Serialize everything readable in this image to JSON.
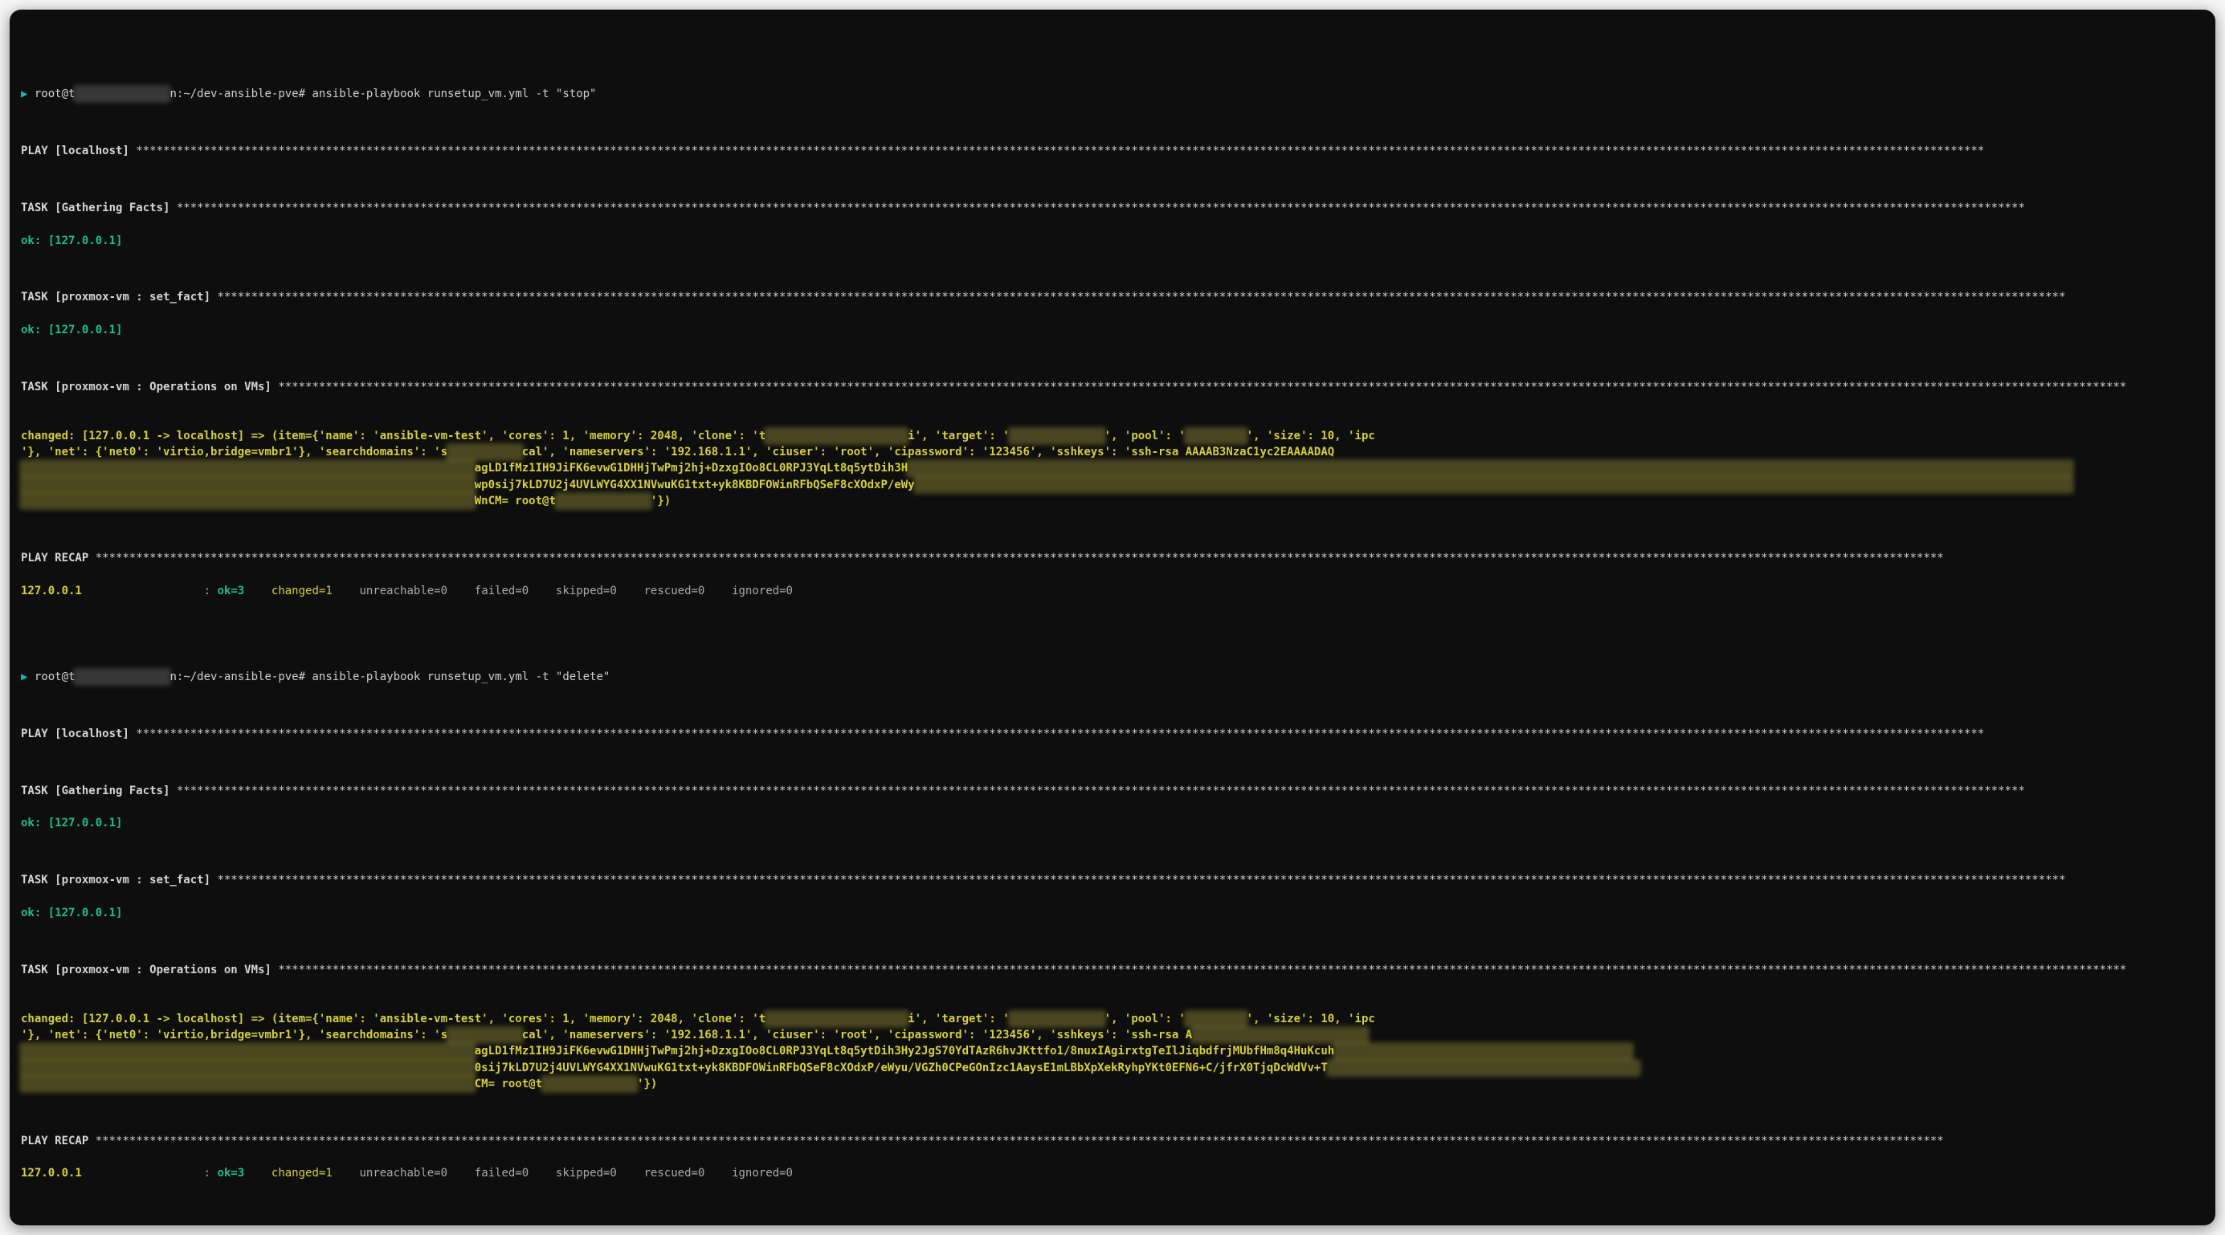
{
  "prompt": {
    "arrow": "▶",
    "user_prefix": "root@t",
    "user_redacted": "xxxxxxxxxxxxxx",
    "path_suffix": "n:~/dev-ansible-pve#",
    "cmd_stop": "ansible-playbook runsetup_vm.yml -t \"stop\"",
    "cmd_delete": "ansible-playbook runsetup_vm.yml -t \"delete\""
  },
  "labels": {
    "play_local": "PLAY [localhost]",
    "task_gather": "TASK [Gathering Facts]",
    "task_setfact": "TASK [proxmox-vm : set_fact]",
    "task_ops": "TASK [proxmox-vm : Operations on VMs]",
    "play_recap": "PLAY RECAP",
    "ok_line": "ok: [127.0.0.1]"
  },
  "stars": "*********************************************************************************************************************************************************************************************************************************************************************************",
  "changed": {
    "prefix": "changed: [127.0.0.1 -> localhost] => (item={'name': 'ansible-vm-test', 'cores': 1, 'memory': 2048, 'clone': 't",
    "after_clone_redact": "i', 'target': '",
    "after_target_redact": "', 'pool': '",
    "after_pool_redact": "', 'size': 10, 'ipc",
    "line2a": "'}, 'net': {'net0': 'virtio,bridge=vmbr1'}, 'searchdomains': 's",
    "line2b": "cal', 'nameservers': '192.168.1.1', 'ciuser': 'root', 'cipassword': '123456', 'sshkeys': 'ssh-rsa AAAAB3NzaC1yc2EAAAADAQ",
    "line3a_stop": "agLD1fMz1IH9JiFK6evwG1DHHjTwPmj2hj+DzxgIOo8CL0RPJ3YqLt8q5ytDih3H",
    "line4a_stop": "wp0sij7kLD7U2j4UVLWYG4XX1NVwuKG1txt+yk8KBDFOWinRFbQSeF8cXOdxP/eWy",
    "line5a_stop": "WnCM= root@t",
    "line5b_stop": "'})",
    "line2b_delete": "cal', 'nameservers': '192.168.1.1', 'ciuser': 'root', 'cipassword': '123456', 'sshkeys': 'ssh-rsa A",
    "line3a_delete": "agLD1fMz1IH9JiFK6evwG1DHHjTwPmj2hj+DzxgIOo8CL0RPJ3YqLt8q5ytDih3Hy2JgS70YdTAzR6hvJKttfo1/8nuxIAgirxtgTeIlJiqbdfrjMUbfHm8q4HuKcuh",
    "line4a_delete": "0sij7kLD7U2j4UVLWYG4XX1NVwuKG1txt+yk8KBDFOWinRFbQSeF8cXOdxP/eWyu/VGZh0CPeGOnIzc1AaysE1mLBbXpXekRyhpYKt0EFN6+C/jfrX0TjqDcWdVv+T",
    "line5a_delete": "CM= root@t",
    "line5b_delete": "'})"
  },
  "recap": {
    "ip": "127.0.0.1",
    "sep": "                  :",
    "ok": "ok=3",
    "changed": "changed=1",
    "unreachable": "unreachable=0",
    "failed": "failed=0",
    "skipped": "skipped=0",
    "rescued": "rescued=0",
    "ignored": "ignored=0"
  }
}
